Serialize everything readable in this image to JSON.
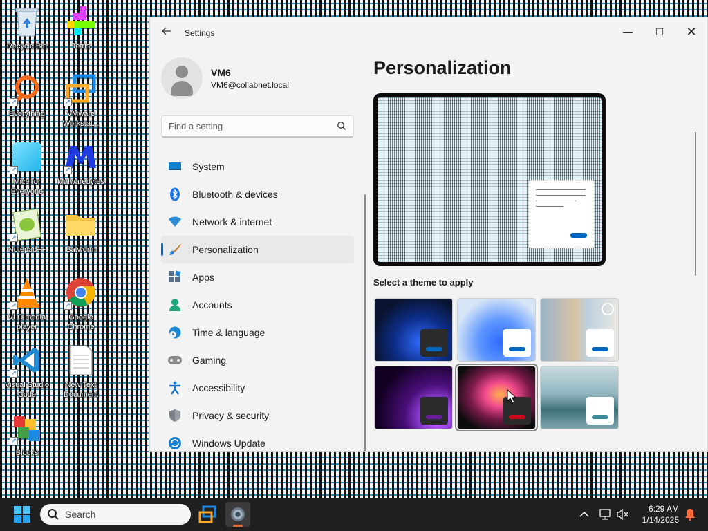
{
  "desktop": {
    "icons": [
      {
        "label": "Recycle Bin",
        "icon": "recycle-bin-icon"
      },
      {
        "label": "Tetris",
        "icon": "tetris-icon"
      },
      {
        "label": "Everything",
        "icon": "everything-search-icon"
      },
      {
        "label": "VMware Workstat...",
        "icon": "vmware-icon"
      },
      {
        "label": "Mice for Everyone",
        "icon": "mice-icon"
      },
      {
        "label": "Malwarebytes",
        "icon": "malwarebytes-icon"
      },
      {
        "label": "Notepad++",
        "icon": "notepadpp-icon"
      },
      {
        "label": "Batworm",
        "icon": "folder-icon"
      },
      {
        "label": "VLC media player",
        "icon": "vlc-icon"
      },
      {
        "label": "Google Chrome",
        "icon": "chrome-icon"
      },
      {
        "label": "Visual Studio Code",
        "icon": "vscode-icon"
      },
      {
        "label": "New Text Document",
        "icon": "text-document-icon"
      },
      {
        "label": "Blocks",
        "icon": "blocks-icon"
      }
    ]
  },
  "window": {
    "app_title": "Settings",
    "controls": {
      "minimize": "—",
      "maximize": "☐",
      "close": "✕"
    }
  },
  "profile": {
    "name": "VM6",
    "email": "VM6@collabnet.local"
  },
  "search": {
    "placeholder": "Find a setting"
  },
  "nav": {
    "items": [
      {
        "label": "System",
        "icon": "system-icon"
      },
      {
        "label": "Bluetooth & devices",
        "icon": "bluetooth-icon"
      },
      {
        "label": "Network & internet",
        "icon": "network-icon"
      },
      {
        "label": "Personalization",
        "icon": "brush-icon",
        "active": true
      },
      {
        "label": "Apps",
        "icon": "apps-icon"
      },
      {
        "label": "Accounts",
        "icon": "accounts-icon"
      },
      {
        "label": "Time & language",
        "icon": "time-language-icon"
      },
      {
        "label": "Gaming",
        "icon": "gaming-icon"
      },
      {
        "label": "Accessibility",
        "icon": "accessibility-icon"
      },
      {
        "label": "Privacy & security",
        "icon": "shield-icon"
      },
      {
        "label": "Windows Update",
        "icon": "windows-update-icon"
      }
    ]
  },
  "main": {
    "title": "Personalization",
    "theme_heading": "Select a theme to apply",
    "themes": [
      {
        "name": "windows-dark",
        "accent": "#0067c0"
      },
      {
        "name": "windows-light",
        "accent": "#0067c0"
      },
      {
        "name": "spotlight",
        "accent": "#0067c0"
      },
      {
        "name": "glow",
        "accent": "#6a1b9a"
      },
      {
        "name": "captured-motion",
        "accent": "#c50f1f",
        "selected": true
      },
      {
        "name": "flow",
        "accent": "#3a8a9a"
      }
    ]
  },
  "taskbar": {
    "search_label": "Search",
    "time": "6:29 AM",
    "date": "1/14/2025"
  },
  "colors": {
    "accent": "#0067c0",
    "taskbar": "#1f1f1f",
    "window_bg": "#f3f3f3"
  }
}
